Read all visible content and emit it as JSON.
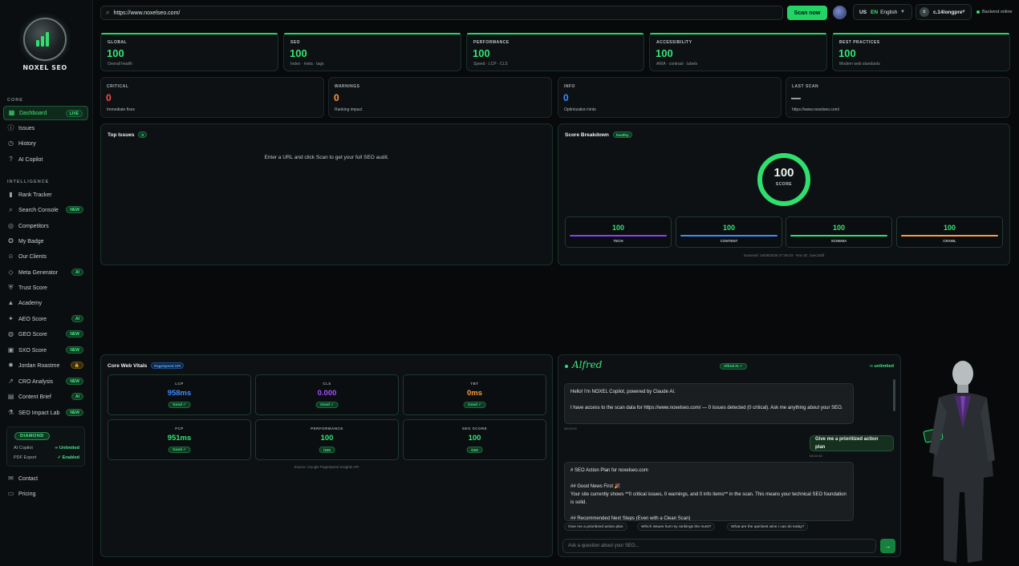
{
  "brand": {
    "logo_text": "NOXEL SEO"
  },
  "sidebar": {
    "sections": [
      {
        "label": "CORE"
      },
      {
        "label": "INTELLIGENCE"
      }
    ],
    "items": [
      {
        "label": "Dashboard",
        "icon": "grid-icon",
        "badge": "LIVE",
        "active": true
      },
      {
        "label": "Issues",
        "icon": "alert-circle-icon"
      },
      {
        "label": "History",
        "icon": "clock-icon"
      },
      {
        "label": "AI Copilot",
        "icon": "help-circle-icon"
      },
      {
        "label": "Rank Tracker",
        "icon": "bar-chart-icon"
      },
      {
        "label": "Search Console",
        "icon": "search-icon",
        "badge": "NEW"
      },
      {
        "label": "Competitors",
        "icon": "target-icon"
      },
      {
        "label": "My Badge",
        "icon": "badge-icon"
      },
      {
        "label": "Our Clients",
        "icon": "users-icon"
      },
      {
        "label": "Meta Generator",
        "icon": "tag-icon",
        "badge": "AI"
      },
      {
        "label": "Trust Score",
        "icon": "shield-icon"
      },
      {
        "label": "Academy",
        "icon": "graduation-cap-icon"
      },
      {
        "label": "AEO Score",
        "icon": "spark-icon",
        "badge": "AI"
      },
      {
        "label": "GEO Score",
        "icon": "globe-icon",
        "badge": "NEW"
      },
      {
        "label": "SXO Score",
        "icon": "cube-icon",
        "badge": "NEW"
      },
      {
        "label": "Jordan Roastme",
        "icon": "flame-icon",
        "badge": "🔒"
      },
      {
        "label": "CRO Analysis",
        "icon": "trend-icon",
        "badge": "NEW"
      },
      {
        "label": "Content Brief",
        "icon": "document-icon",
        "badge": "AI"
      },
      {
        "label": "SEO Impact Lab",
        "icon": "flask-icon",
        "badge": "NEW"
      },
      {
        "label": "Contact",
        "icon": "mail-icon"
      },
      {
        "label": "Pricing",
        "icon": "card-icon"
      }
    ],
    "plan": {
      "name": "DIAMOND",
      "rows": [
        {
          "label": "AI Copilot",
          "value": "∞ Unlimited"
        },
        {
          "label": "PDF Export",
          "value": "✓ Enabled"
        }
      ]
    }
  },
  "topbar": {
    "url": "https://www.noxelseo.com/",
    "scan_label": "Scan now",
    "lang_flag": "US",
    "lang_code": "EN",
    "lang_name": "English",
    "user_initial": "c",
    "user_name": "c.14longpre",
    "status": "Backend online"
  },
  "metrics": [
    {
      "label": "GLOBAL",
      "value": "100",
      "sub": "Overall health"
    },
    {
      "label": "SEO",
      "value": "100",
      "sub": "Index · meta · tags"
    },
    {
      "label": "PERFORMANCE",
      "value": "100",
      "sub": "Speed · LCP · CLS"
    },
    {
      "label": "ACCESSIBILITY",
      "value": "100",
      "sub": "ARIA · contrast · labels"
    },
    {
      "label": "BEST PRACTICES",
      "value": "100",
      "sub": "Modern web standards"
    }
  ],
  "counts": [
    {
      "label": "CRITICAL",
      "value": "0",
      "sub": "Immediate fixes",
      "color": "#ff4b4b"
    },
    {
      "label": "WARNINGS",
      "value": "0",
      "sub": "Ranking impact",
      "color": "#ff9a3c"
    },
    {
      "label": "INFO",
      "value": "0",
      "sub": "Optimization hints",
      "color": "#3d8bff"
    },
    {
      "label": "LAST SCAN",
      "value": "—",
      "sub": "https://www.noxelseo.com/",
      "color": "#eef1f0"
    }
  ],
  "top_issues": {
    "title": "Top Issues",
    "count": "0",
    "empty": "Enter a URL and click Scan to get your full SEO audit."
  },
  "breakdown": {
    "title": "Score Breakdown",
    "chip": "healthy",
    "score": "100",
    "score_label": "SCORE",
    "score_fraction": 1.0,
    "subs": [
      {
        "label": "TECH",
        "value": "100",
        "color": "#8b3dff"
      },
      {
        "label": "CONTENT",
        "value": "100",
        "color": "#3d8bff"
      },
      {
        "label": "SCHEMA",
        "value": "100",
        "color": "#2fe06e"
      },
      {
        "label": "CRAWL",
        "value": "100",
        "color": "#ff9a3c"
      }
    ],
    "scanned": "Scanned: 16/09/2026 07:36:03 · Run ID: 2aec3ddf"
  },
  "vitals": {
    "title": "Core Web Vitals",
    "chip": "PageSpeed API",
    "items": [
      {
        "label": "LCP",
        "value": "958ms",
        "status": "Good ✓",
        "color": "#3d8bff"
      },
      {
        "label": "CLS",
        "value": "0.000",
        "status": "Good ✓",
        "color": "#a64dff"
      },
      {
        "label": "TBT",
        "value": "0ms",
        "status": "Good ✓",
        "color": "#ff9a3c"
      },
      {
        "label": "FCP",
        "value": "951ms",
        "status": "Good ✓",
        "color": "#34e474"
      },
      {
        "label": "PERFORMANCE",
        "value": "100",
        "status": "/100",
        "color": "#34e474"
      },
      {
        "label": "SEO SCORE",
        "value": "100",
        "status": "/100",
        "color": "#34e474"
      }
    ],
    "source": "Source: Google PageSpeed Insights API"
  },
  "chat": {
    "name": "Alfred",
    "ai_chip": "Alfred AI ✓",
    "quota": "∞ unlimited",
    "bot1_line1": "Hello! I'm NOXEL Copilot, powered by Claude AI.",
    "bot1_line2": "I have access to the scan data for https://www.noxelseo.com/ — 0 issues detected (0 critical). Ask me anything about your SEO.",
    "ts1": "08:02:09",
    "user_msg": "Give me a prioritized action plan",
    "ts2": "08:02:48",
    "bot2_l1": "# SEO Action Plan for noxelseo.com",
    "bot2_l2": "## Good News First 🎉",
    "bot2_l3": "Your site currently shows **0 critical issues, 0 warnings, and 0 info items** in the scan. This means your technical SEO foundation is solid.",
    "bot2_l4": "## Recommended Next Steps (Even with a Clean Scan)",
    "suggestions": [
      "Give me a prioritized action plan",
      "Which issues hurt my rankings the most?",
      "What are the quickest wins I can do today?"
    ],
    "placeholder": "Ask a question about your SEO...",
    "send_icon": "→"
  }
}
